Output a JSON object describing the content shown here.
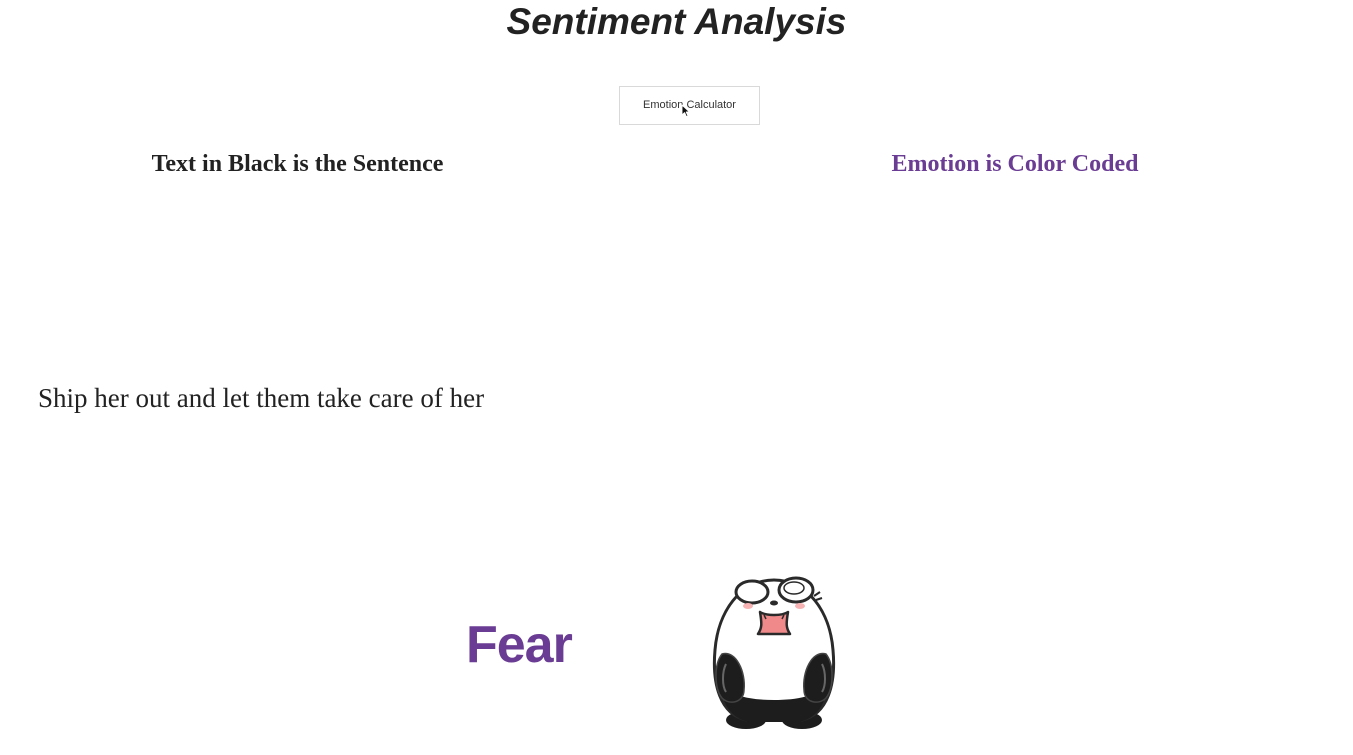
{
  "page": {
    "title": "Sentiment Analysis"
  },
  "toolbar": {
    "calculator_label": "Emotion Calculator"
  },
  "headings": {
    "sentence_heading": "Text in Black is the Sentence",
    "emotion_heading": "Emotion is Color Coded"
  },
  "result": {
    "sentence": "Ship her out and let them take care of her",
    "emotion": "Fear",
    "emotion_color": "#6a3c93",
    "illustration_icon": "scared-panda-icon"
  },
  "colors": {
    "text": "#222222",
    "accent": "#6a3c93",
    "button_border": "#d9d9d9"
  }
}
